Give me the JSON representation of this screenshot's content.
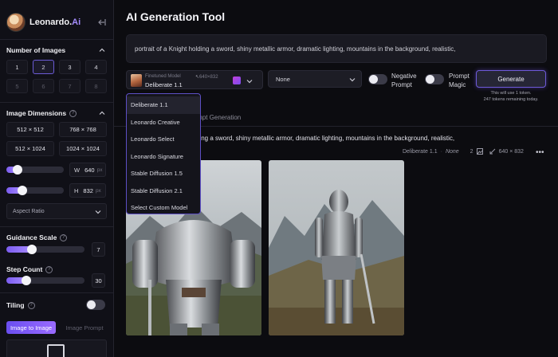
{
  "sidebar": {
    "logo_text": "Leonardo.",
    "logo_ai": "Ai",
    "num_images_title": "Number of Images",
    "num_images": [
      "1",
      "2",
      "3",
      "4",
      "5",
      "6",
      "7",
      "8"
    ],
    "num_images_selected": "2",
    "dimensions_title": "Image Dimensions",
    "dimensions": [
      "512 × 512",
      "768 × 768",
      "512 × 1024",
      "1024 × 1024"
    ],
    "width_label": "W",
    "width_value": "640",
    "height_label": "H",
    "height_value": "832",
    "unit": "px",
    "width_slider_fraction": 0.2,
    "height_slider_fraction": 0.28,
    "aspect_ratio_label": "Aspect Ratio",
    "guidance_title": "Guidance Scale",
    "guidance_value": "7",
    "guidance_fraction": 0.33,
    "step_title": "Step Count",
    "step_value": "30",
    "step_fraction": 0.26,
    "tiling_title": "Tiling",
    "tiling_on": false,
    "image_to_image_label": "Image to Image",
    "image_prompt_label": "Image Prompt"
  },
  "main": {
    "title": "AI Generation Tool",
    "prompt": "portrait of a Knight holding a sword, shiny metallic armor, dramatic lighting, mountains in the background, realistic,",
    "model": {
      "caption": "Finetuned Model",
      "name": "Deliberate 1.1",
      "resolution": "640×832"
    },
    "style_select": "None",
    "negative_prompt_label": "Negative Prompt",
    "negative_prompt_on": false,
    "prompt_magic_label": "Prompt Magic",
    "prompt_magic_on": false,
    "generate_label": "Generate",
    "token_line1": "This will use 1 token.",
    "token_line2": "247 tokens remaining today.",
    "tab_prompt_generation": "rompt Generation",
    "history_prompt": "ding a sword, shiny metallic armor, dramatic lighting, mountains in the background, realistic,",
    "history_model": "Deliberate 1.1",
    "history_style": "None",
    "history_count": "2",
    "history_resolution": "640 × 832"
  },
  "dropdown": {
    "items": [
      "Deliberate 1.1",
      "Leonardo Creative",
      "Leonardo Select",
      "Leonardo Signature",
      "Stable Diffusion 1.5",
      "Stable Diffusion 2.1",
      "Select Custom Model"
    ],
    "active": "Deliberate 1.1"
  },
  "colors": {
    "accent": "#7b5cf0",
    "accent_light": "#a78bff",
    "background": "#0c0c10",
    "panel": "#1a1a22"
  }
}
